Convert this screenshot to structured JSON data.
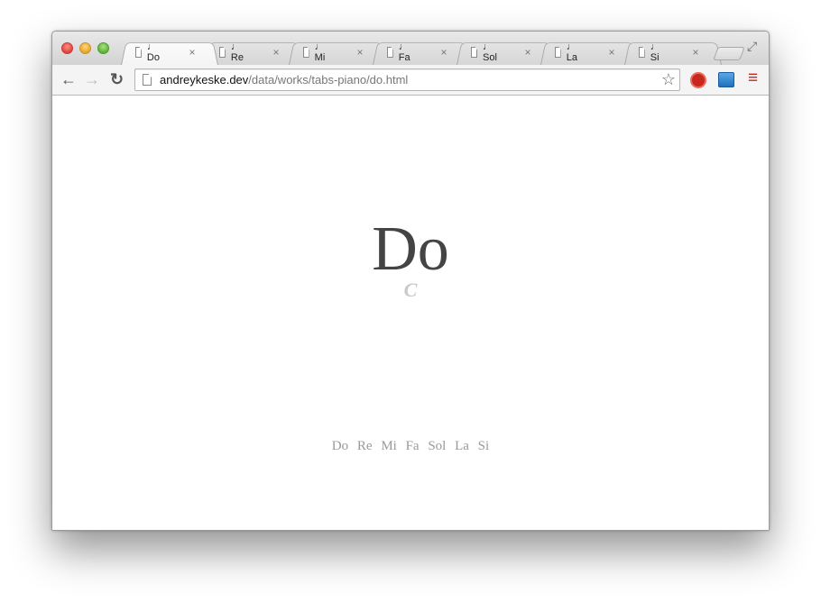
{
  "browser": {
    "tabs": [
      {
        "label": "♩ Do",
        "active": true
      },
      {
        "label": "♩ Re",
        "active": false
      },
      {
        "label": "♩ Mi",
        "active": false
      },
      {
        "label": "♩ Fa",
        "active": false
      },
      {
        "label": "♩ Sol",
        "active": false
      },
      {
        "label": "♩ La",
        "active": false
      },
      {
        "label": "♩ Si",
        "active": false
      }
    ],
    "tab_close_glyph": "×",
    "url_host": "andreykeske.dev",
    "url_path": "/data/works/tabs-piano/do.html",
    "icons": {
      "back": "←",
      "forward": "→",
      "reload": "↻",
      "star": "☆",
      "menu": "≡",
      "fullscreen": "⤢"
    },
    "colors": {
      "menu_accent": "#c5281c",
      "stop_extension": "#c8271c"
    }
  },
  "page": {
    "note_name": "Do",
    "note_letter": "C",
    "nav": [
      "Do",
      "Re",
      "Mi",
      "Fa",
      "Sol",
      "La",
      "Si"
    ]
  }
}
